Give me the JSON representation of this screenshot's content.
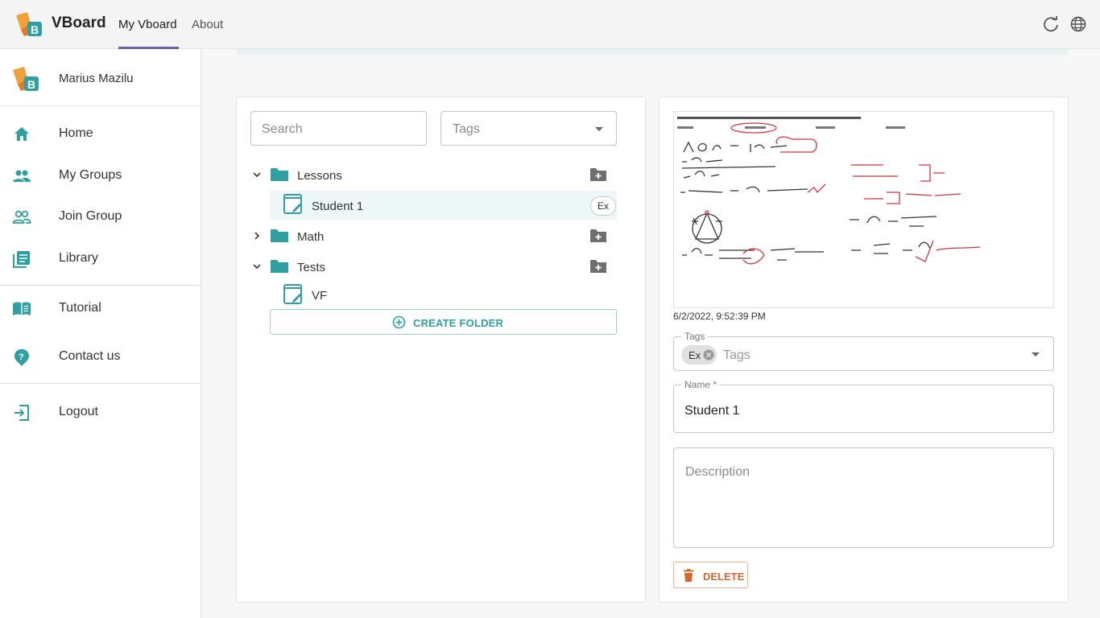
{
  "header": {
    "app_name": "VBoard",
    "tabs": [
      {
        "label": "My Vboard",
        "active": true
      },
      {
        "label": "About",
        "active": false
      }
    ],
    "icons": [
      "refresh-icon",
      "globe-icon"
    ],
    "accent": "#6264a7"
  },
  "sidebar": {
    "user_name": "Marius Mazilu",
    "items": [
      {
        "label": "Home",
        "icon": "home-icon"
      },
      {
        "label": "My Groups",
        "icon": "groups-icon"
      },
      {
        "label": "Join Group",
        "icon": "join-group-icon"
      },
      {
        "label": "Library",
        "icon": "library-icon"
      },
      {
        "label": "Tutorial",
        "icon": "tutorial-icon"
      },
      {
        "label": "Contact us",
        "icon": "help-icon"
      },
      {
        "label": "Logout",
        "icon": "logout-icon"
      }
    ],
    "icon_color": "#2f9fa3"
  },
  "browser": {
    "search_placeholder": "Search",
    "tags_placeholder": "Tags",
    "tree": [
      {
        "type": "folder",
        "label": "Lessons",
        "expanded": true
      },
      {
        "type": "board",
        "label": "Student 1",
        "tag": "Ex",
        "selected": true
      },
      {
        "type": "folder",
        "label": "Math",
        "expanded": false
      },
      {
        "type": "folder",
        "label": "Tests",
        "expanded": true
      },
      {
        "type": "board",
        "label": "VF"
      }
    ],
    "create_folder_label": "CREATE FOLDER"
  },
  "details": {
    "timestamp": "6/2/2022, 9:52:39 PM",
    "tags_label": "Tags",
    "tags_placeholder": "Tags",
    "selected_tags": [
      "Ex"
    ],
    "name_label": "Name *",
    "name_value": "Student 1",
    "description_placeholder": "Description",
    "delete_label": "DELETE"
  }
}
